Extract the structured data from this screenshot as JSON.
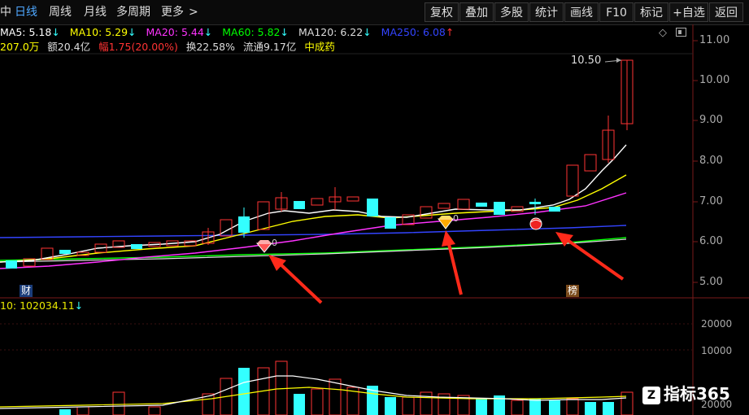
{
  "toolbar": {
    "period_tabs": [
      "中",
      "日线",
      "周线",
      "月线",
      "多周期",
      "更多"
    ],
    "more_arrow": ">",
    "buttons": [
      "复权",
      "叠加",
      "多股",
      "统计",
      "画线",
      "F10",
      "标记",
      "+自选",
      "返回"
    ]
  },
  "ma_row": {
    "ma5": "MA5: 5.18",
    "ma10": "MA10: 5.29",
    "ma20": "MA20: 5.44",
    "ma60": "MA60: 5.82",
    "ma120": "MA120: 6.22",
    "ma250": "MA250: 6.08",
    "arrow_down": "↓",
    "arrow_up": "↑",
    "colors": {
      "ma5": "#ffffff",
      "ma10": "#ffff00",
      "ma20": "#ff33ff",
      "ma60": "#00ff00",
      "ma120": "#dddddd",
      "ma250": "#3344ff"
    }
  },
  "info_row": {
    "volume": "207.0万",
    "amount": "额20.4亿",
    "range": "幅1.75(20.00%)",
    "turnover": "换22.58%",
    "float": "流通9.17亿",
    "sector": "中成药"
  },
  "price_axis": [
    "11.00",
    "10.00",
    "9.00",
    "8.00",
    "7.00",
    "6.00",
    "5.00"
  ],
  "high_annotation": "10.50",
  "tags": {
    "cai": "财",
    "bang": "榜"
  },
  "volume_panel": {
    "header": "10: 102034.11",
    "axis": [
      "20000",
      "10000",
      "20000"
    ]
  },
  "watermark": {
    "logo": "Z",
    "text": "指标365"
  },
  "icons": [
    "diamond-icon",
    "window-restore-icon",
    "gem-icon",
    "ball-icon",
    "arrow-icon"
  ],
  "colors": {
    "up": "#ff3333",
    "down": "#33ffff",
    "active_tab": "#4fa8ff",
    "background": "#000000",
    "annotation_arrow": "#ff2a1a"
  }
}
